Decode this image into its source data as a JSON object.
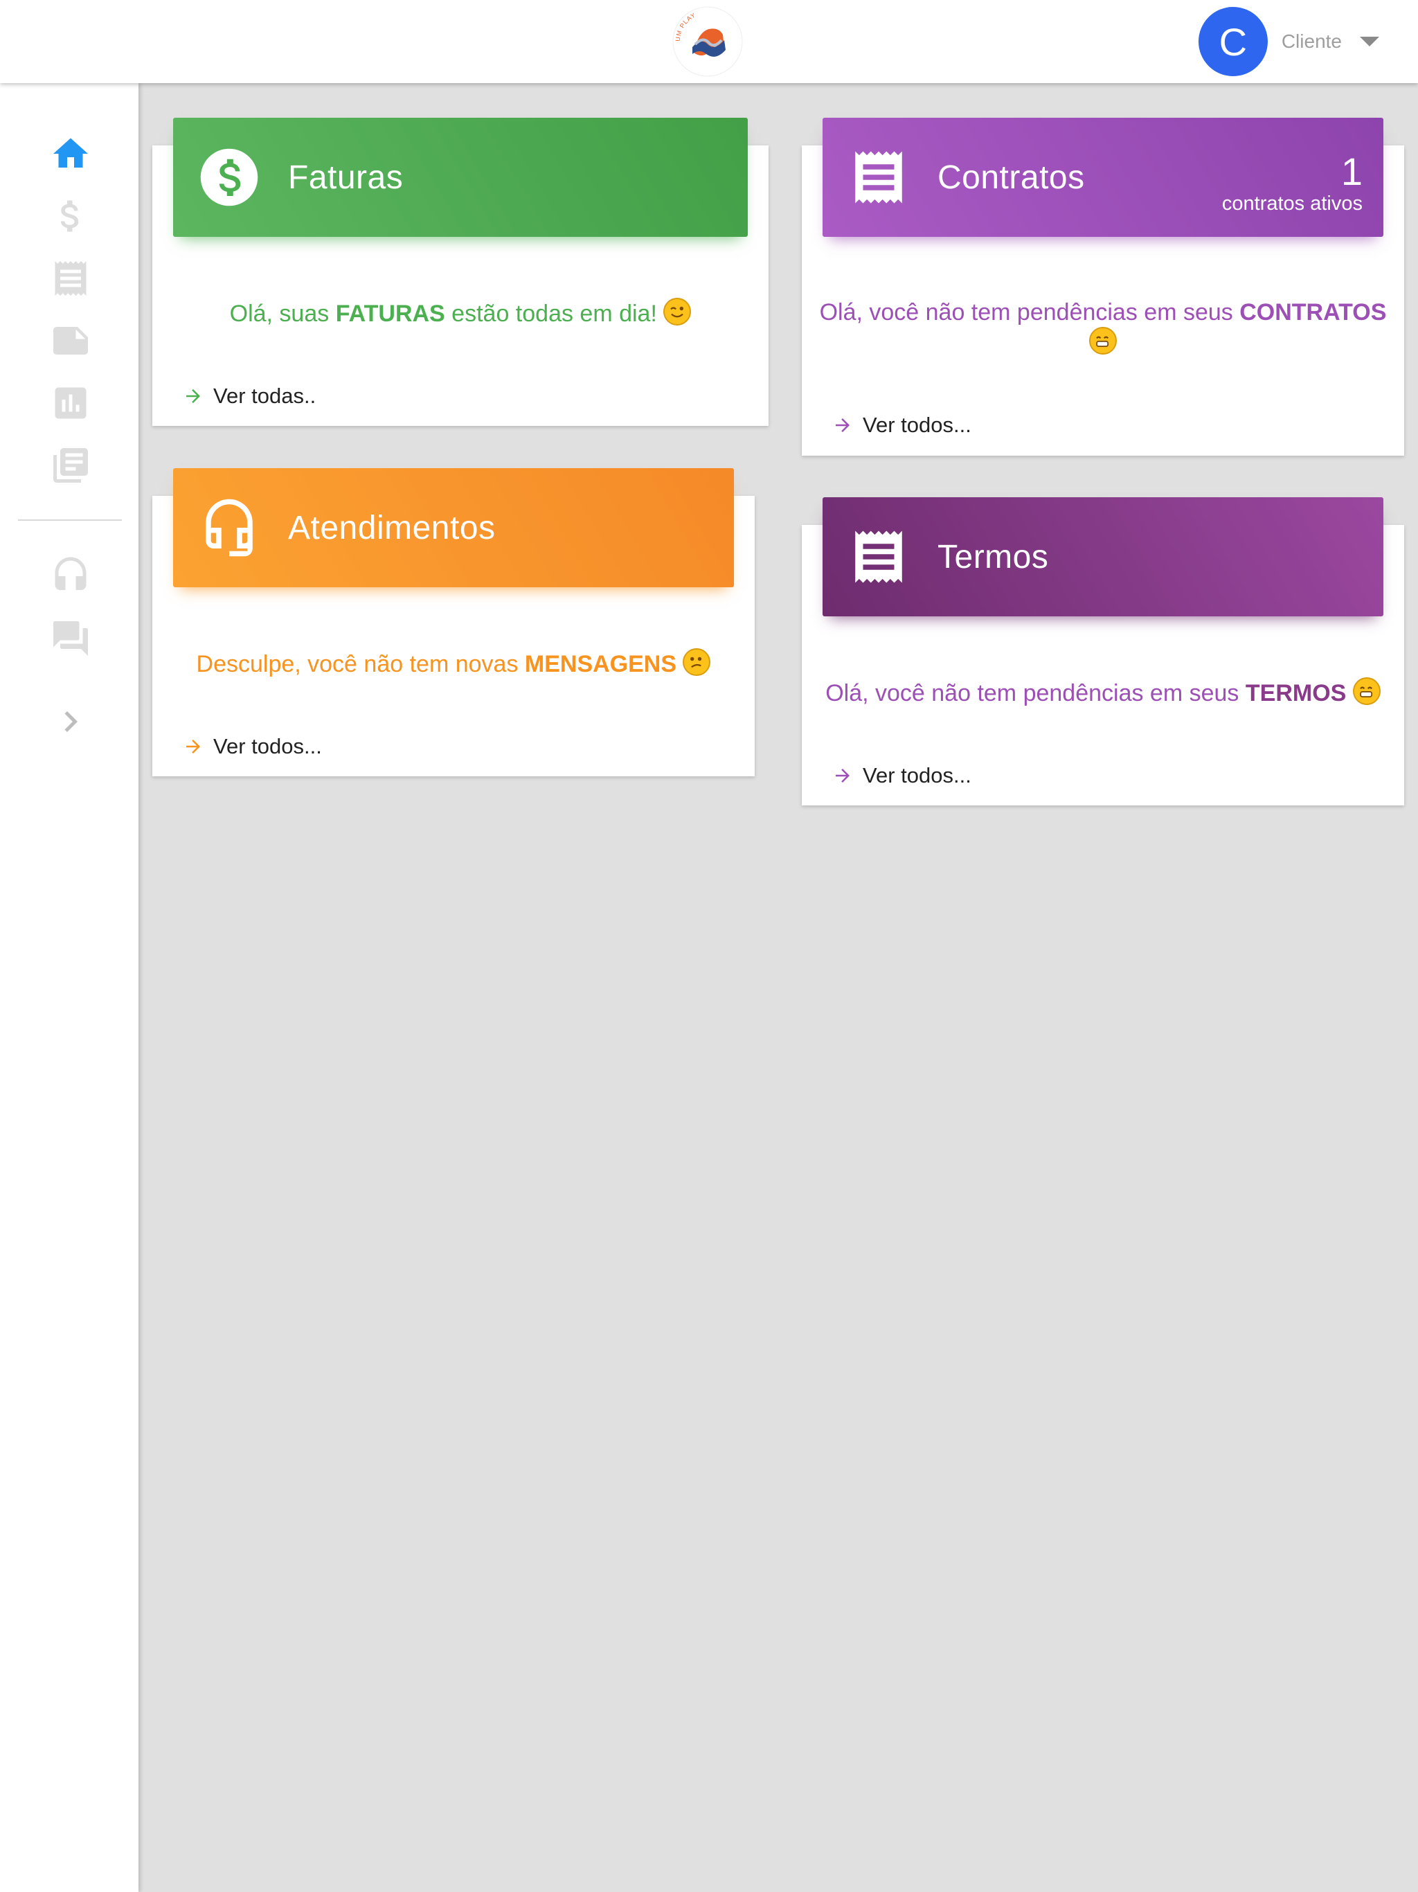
{
  "header": {
    "brand_text": "UM PLAY",
    "avatar_letter": "C",
    "user_label": "Cliente"
  },
  "sidebar": {
    "items": [
      {
        "icon": "home-icon",
        "active": true
      },
      {
        "icon": "dollar-icon"
      },
      {
        "icon": "receipt-icon"
      },
      {
        "icon": "note-icon"
      },
      {
        "icon": "chart-icon"
      },
      {
        "icon": "library-icon"
      },
      {
        "icon": "headset-icon"
      },
      {
        "icon": "forum-icon"
      },
      {
        "icon": "chevron-right-icon"
      }
    ],
    "active_color": "#2196f3",
    "inactive_color": "#dddddd"
  },
  "cards": {
    "faturas": {
      "title": "Faturas",
      "msg_prefix": "Olá, suas ",
      "msg_bold": "FATURAS",
      "msg_suffix": " estão todas em dia!",
      "link": "Ver todas..",
      "color": "#4caf50",
      "emoji": "wink"
    },
    "contratos": {
      "title": "Contratos",
      "count": "1",
      "count_label": "contratos ativos",
      "msg_prefix": "Olá, você não tem pendências em seus ",
      "msg_bold": "CONTRATOS",
      "msg_suffix": "",
      "link": "Ver todos...",
      "color": "#9c4fb5",
      "emoji": "grin"
    },
    "atendimentos": {
      "title": "Atendimentos",
      "msg_prefix": "Desculpe, você não tem novas ",
      "msg_bold": "MENSAGENS",
      "msg_suffix": "",
      "link": "Ver todos...",
      "color": "#f7931e",
      "emoji": "confused"
    },
    "termos": {
      "title": "Termos",
      "msg_prefix": "Olá, você não tem pendências em seus ",
      "msg_bold": "TERMOS",
      "msg_suffix": "",
      "link": "Ver todos...",
      "color": "#8a3a8a",
      "emoji": "grin"
    }
  }
}
